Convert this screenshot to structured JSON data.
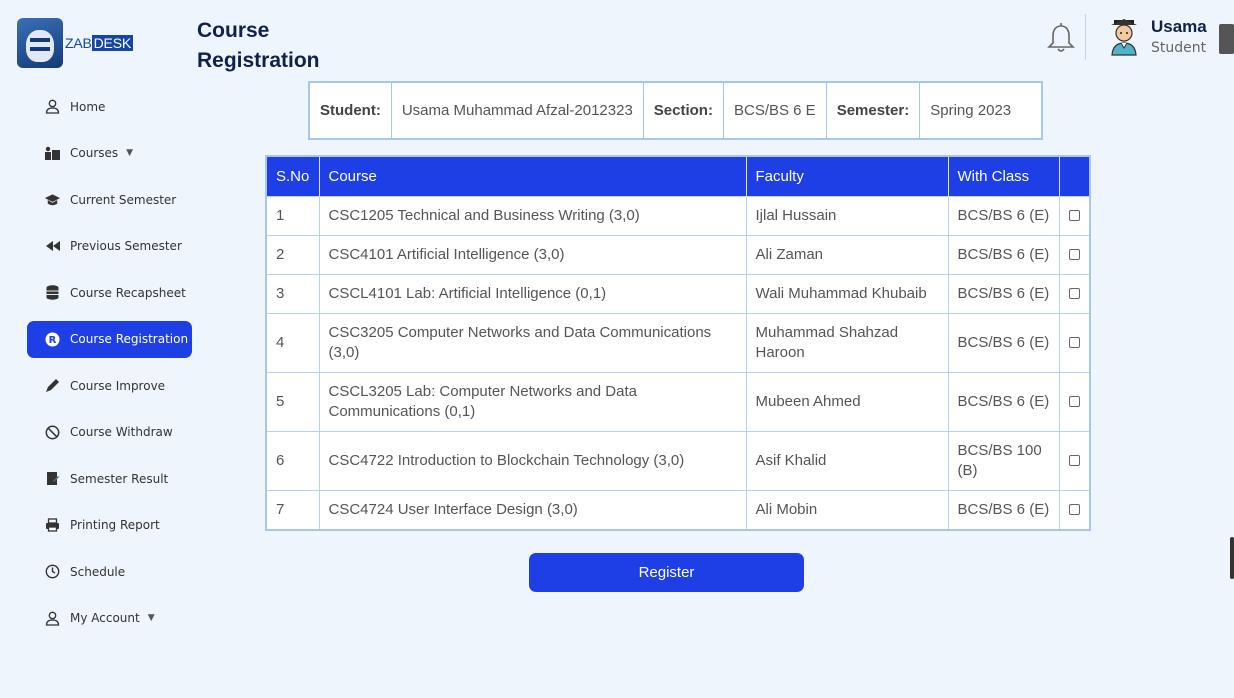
{
  "brand": {
    "logo_text": "ZAB",
    "logo_text_box": "DESK"
  },
  "page": {
    "title": "Course Registration"
  },
  "user": {
    "name": "Usama",
    "role": "Student"
  },
  "sidebar": {
    "items": [
      {
        "label": "Home",
        "icon": "user-icon"
      },
      {
        "label": "Courses",
        "icon": "courses-icon",
        "dropdown": true
      },
      {
        "label": "Current Semester",
        "icon": "graduation-cap-icon"
      },
      {
        "label": "Previous Semester",
        "icon": "rewind-icon"
      },
      {
        "label": "Course Recapsheet",
        "icon": "database-icon"
      },
      {
        "label": "Course Registration",
        "icon": "registered-icon",
        "active": true
      },
      {
        "label": "Course Improve",
        "icon": "pen-icon"
      },
      {
        "label": "Course Withdraw",
        "icon": "ban-icon"
      },
      {
        "label": "Semester Result",
        "icon": "result-icon"
      },
      {
        "label": "Printing Report",
        "icon": "printer-icon"
      },
      {
        "label": "Schedule",
        "icon": "clock-icon"
      },
      {
        "label": "My Account",
        "icon": "user-icon",
        "dropdown": true
      }
    ]
  },
  "info": {
    "student_label": "Student:",
    "student_value": "Usama Muhammad Afzal-2012323",
    "section_label": "Section:",
    "section_value": "BCS/BS 6 E",
    "semester_label": "Semester:",
    "semester_value": "Spring 2023"
  },
  "table": {
    "headers": [
      "S.No",
      "Course",
      "Faculty",
      "With Class",
      ""
    ],
    "rows": [
      {
        "sno": "1",
        "course": "CSC1205 Technical and Business Writing (3,0)",
        "faculty": "Ijlal Hussain",
        "class": "BCS/BS 6 (E)",
        "checked": false
      },
      {
        "sno": "2",
        "course": "CSC4101 Artificial Intelligence (3,0)",
        "faculty": "Ali Zaman",
        "class": "BCS/BS 6 (E)",
        "checked": false
      },
      {
        "sno": "3",
        "course": "CSCL4101 Lab: Artificial Intelligence (0,1)",
        "faculty": "Wali Muhammad Khubaib",
        "class": "BCS/BS 6 (E)",
        "checked": false
      },
      {
        "sno": "4",
        "course": "CSC3205 Computer Networks and Data Communications (3,0)",
        "faculty": "Muhammad Shahzad Haroon",
        "class": "BCS/BS 6 (E)",
        "checked": false
      },
      {
        "sno": "5",
        "course": "CSCL3205 Lab: Computer Networks and Data Communications (0,1)",
        "faculty": "Mubeen Ahmed",
        "class": "BCS/BS 6 (E)",
        "checked": false
      },
      {
        "sno": "6",
        "course": "CSC4722 Introduction to Blockchain Technology (3,0)",
        "faculty": "Asif Khalid",
        "class": "BCS/BS 100 (B)",
        "checked": false
      },
      {
        "sno": "7",
        "course": "CSC4724 User Interface Design (3,0)",
        "faculty": "Ali Mobin",
        "class": "BCS/BS 6 (E)",
        "checked": false
      }
    ]
  },
  "actions": {
    "register_label": "Register"
  },
  "colors": {
    "accent": "#1f3fe6",
    "background": "#eef5fd",
    "border": "#a9c6ea",
    "title": "#10224c"
  }
}
